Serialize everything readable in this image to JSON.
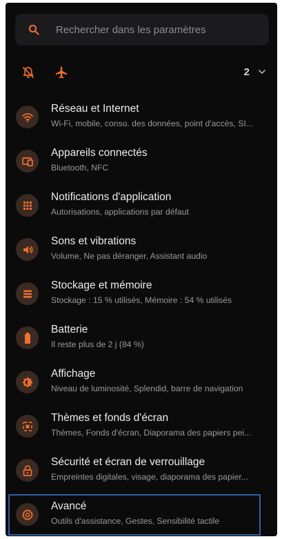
{
  "colors": {
    "accent": "#f0702e",
    "background": "#0b0b0c",
    "highlight_border": "#2e60a8"
  },
  "search": {
    "icon": "search-icon",
    "placeholder": "Rechercher dans les paramètres"
  },
  "quick_settings": {
    "icons": [
      "do-not-disturb-off-icon",
      "airplane-icon"
    ],
    "count": "2",
    "expand_icon": "chevron-down-icon"
  },
  "settings": [
    {
      "icon": "wifi-icon",
      "title": "Réseau et Internet",
      "subtitle": "Wi-Fi, mobile, conso. des données, point d'accès, SI..."
    },
    {
      "icon": "connected-devices-icon",
      "title": "Appareils connectés",
      "subtitle": "Bluetooth, NFC"
    },
    {
      "icon": "apps-grid-icon",
      "title": "Notifications d'application",
      "subtitle": "Autorisations, applications par défaut"
    },
    {
      "icon": "speaker-icon",
      "title": "Sons et vibrations",
      "subtitle": "Volume, Ne pas déranger, Assistant audio"
    },
    {
      "icon": "storage-icon",
      "title": "Stockage et mémoire",
      "subtitle": "Stockage : 15 % utilisés, Mémoire : 54 % utilisés"
    },
    {
      "icon": "battery-icon",
      "title": "Batterie",
      "subtitle": "Il reste plus de 2 j (84 %)"
    },
    {
      "icon": "brightness-icon",
      "title": "Affichage",
      "subtitle": "Niveau de luminosité, Splendid, barre de navigation"
    },
    {
      "icon": "themes-icon",
      "title": "Thèmes et fonds d'écran",
      "subtitle": "Thèmes, Fonds d'écran, Diaporama des papiers pei..."
    },
    {
      "icon": "lock-icon",
      "title": "Sécurité et écran de verrouillage",
      "subtitle": "Empreintes digitales, visage, diaporama des papier..."
    },
    {
      "icon": "gear-icon",
      "title": "Avancé",
      "subtitle": "Outils d'assistance, Gestes, Sensibilité tactile"
    }
  ]
}
